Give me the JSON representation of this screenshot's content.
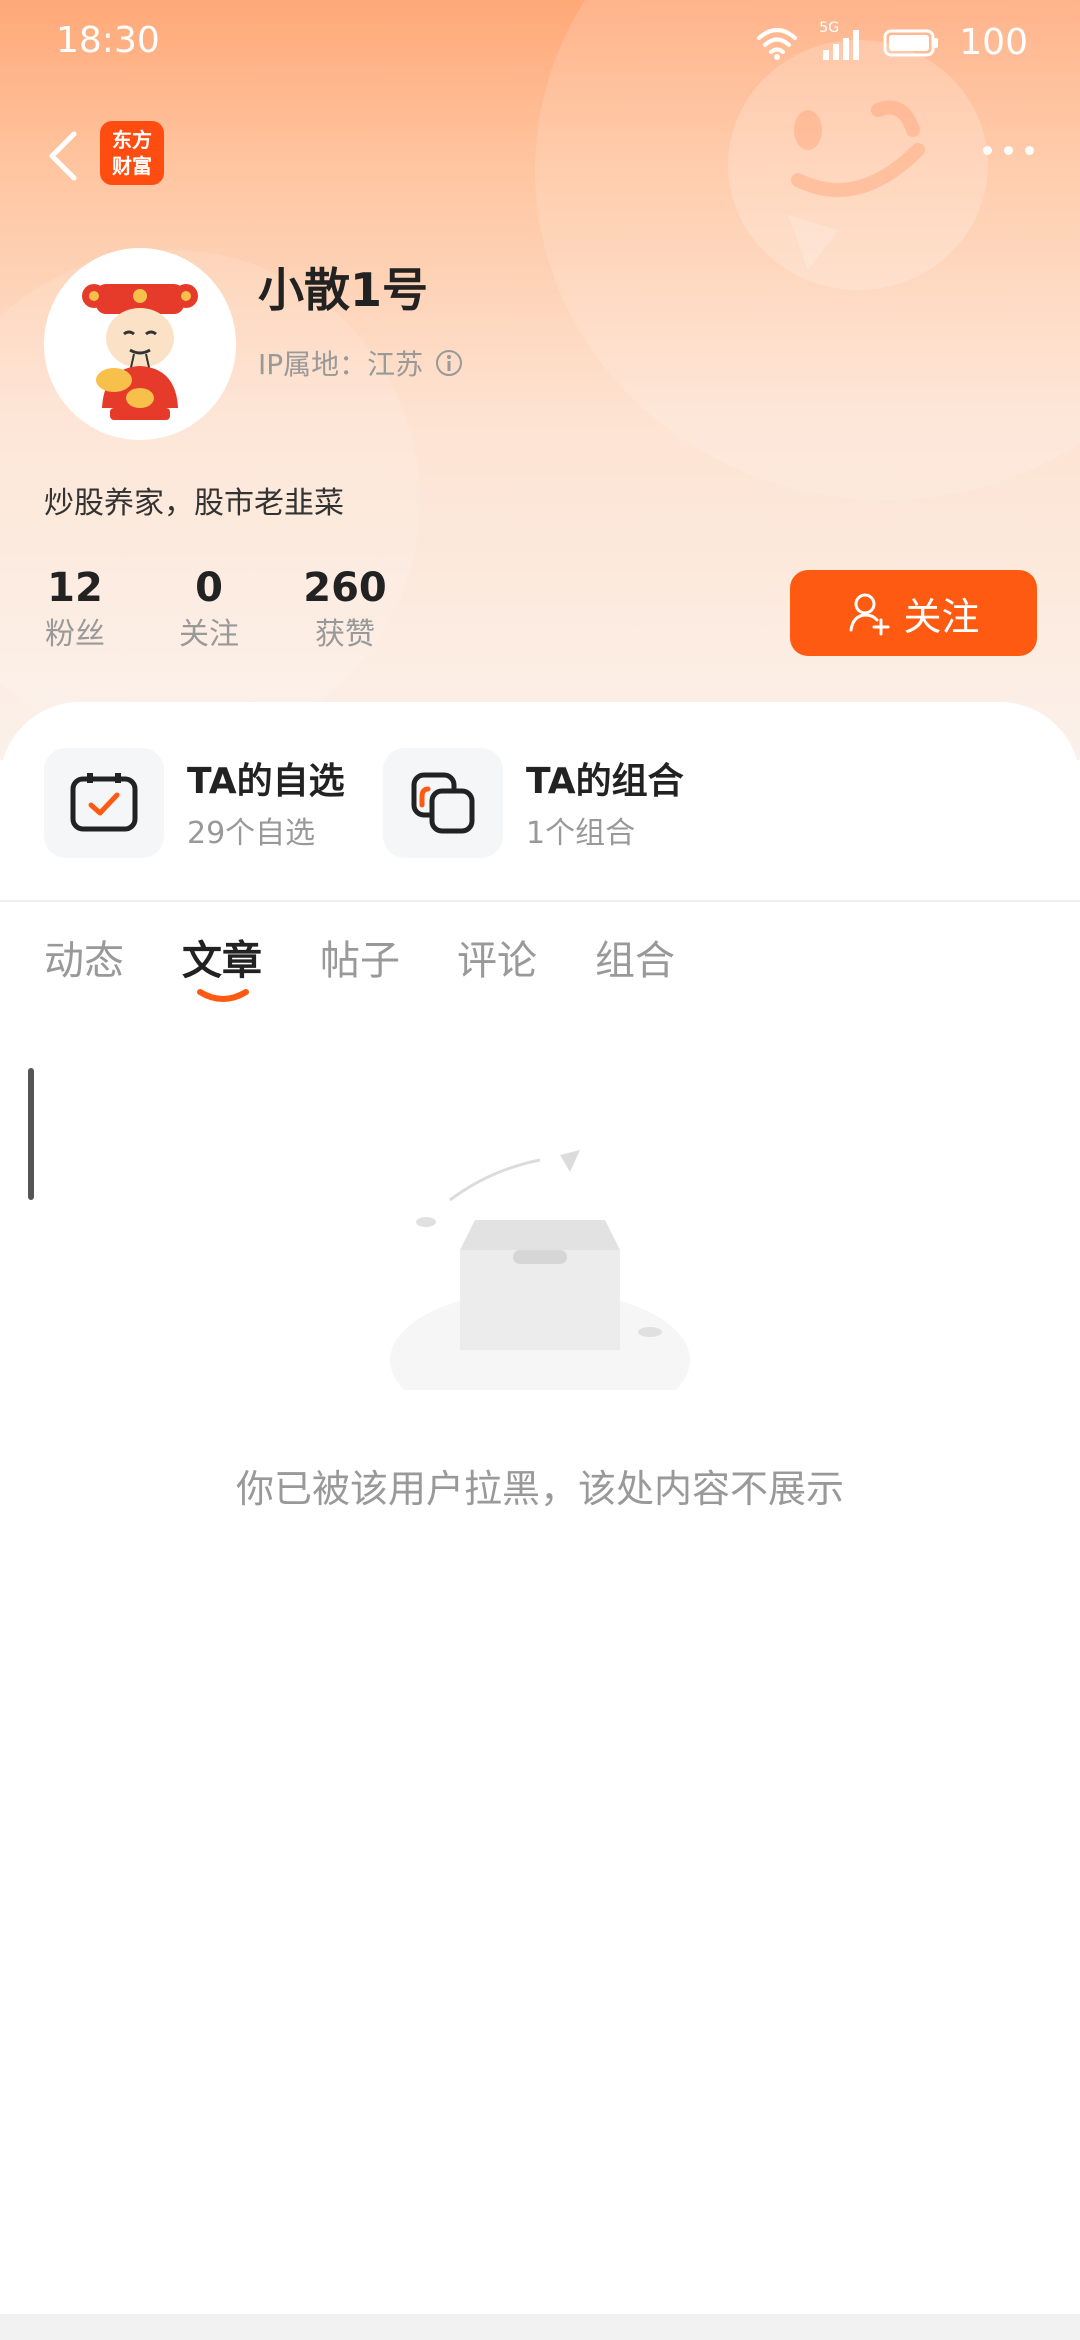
{
  "status_bar": {
    "time": "18:30",
    "battery": "100",
    "network_label": "5G"
  },
  "app": {
    "logo_text_line1": "东方",
    "logo_text_line2": "财富",
    "accent_color": "#ff5a12"
  },
  "profile": {
    "username": "小散1号",
    "ip_location": "IP属地：江苏",
    "bio": "炒股养家，股市老韭菜",
    "stats": [
      {
        "value": "12",
        "label": "粉丝"
      },
      {
        "value": "0",
        "label": "关注"
      },
      {
        "value": "260",
        "label": "获赞"
      }
    ],
    "follow_label": "关注"
  },
  "shortcuts": [
    {
      "title": "TA的自选",
      "subtitle": "29个自选",
      "icon": "checkbox-icon"
    },
    {
      "title": "TA的组合",
      "subtitle": "1个组合",
      "icon": "portfolio-icon"
    }
  ],
  "tabs": [
    {
      "label": "动态",
      "active": false
    },
    {
      "label": "文章",
      "active": true
    },
    {
      "label": "帖子",
      "active": false
    },
    {
      "label": "评论",
      "active": false
    },
    {
      "label": "组合",
      "active": false
    }
  ],
  "empty_state": {
    "message": "你已被该用户拉黑，该处内容不展示"
  }
}
